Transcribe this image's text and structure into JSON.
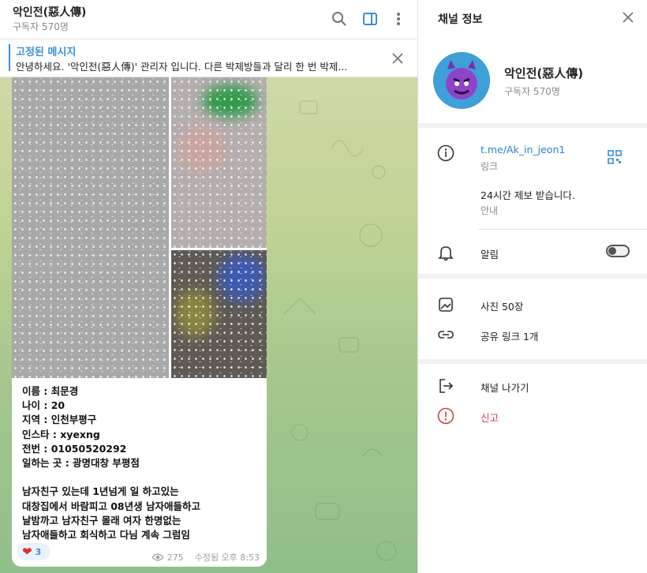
{
  "chat": {
    "title": "악인전(惡人傳)",
    "subtitle": "구독자 570명",
    "pinned_title": "고정된 메시지",
    "pinned_text": "안녕하세요. '악인전(惡人傳)' 관리자 입니다. 다른 박제방들과 달리 한 번 박제...",
    "message_text": "이름 : 최문경\n나이 : 20\n지역 : 인천부평구\n인스타 : xyexng\n전번 : 01050520292\n일하는 곳 : 광명대창 부평점\n\n남자친구 있는데 1년넘게 일 하고있는\n대창집에서 바람피고 08년생 남자애들하고\n날밤까고 남자친구 몰래 여자 한명없는\n남자애들하고 회식하고 다님 계속 그럼임",
    "reaction_count": "3",
    "views": "275",
    "edited_time": "수정됨 오후 8:53"
  },
  "panel": {
    "title": "채널 정보",
    "channel_name": "악인전(惡人傳)",
    "channel_sub": "구독자 570명",
    "link": "t.me/Ak_in_jeon1",
    "link_caption": "링크",
    "description": "24시간 제보 받습니다.",
    "description_caption": "안내",
    "notifications": "알림",
    "photos": "사진 50장",
    "shared_links": "공유 링크 1개",
    "leave": "채널 나가기",
    "report": "신고"
  },
  "colors": {
    "accent": "#3a8fd6",
    "danger": "#d63b3b"
  }
}
